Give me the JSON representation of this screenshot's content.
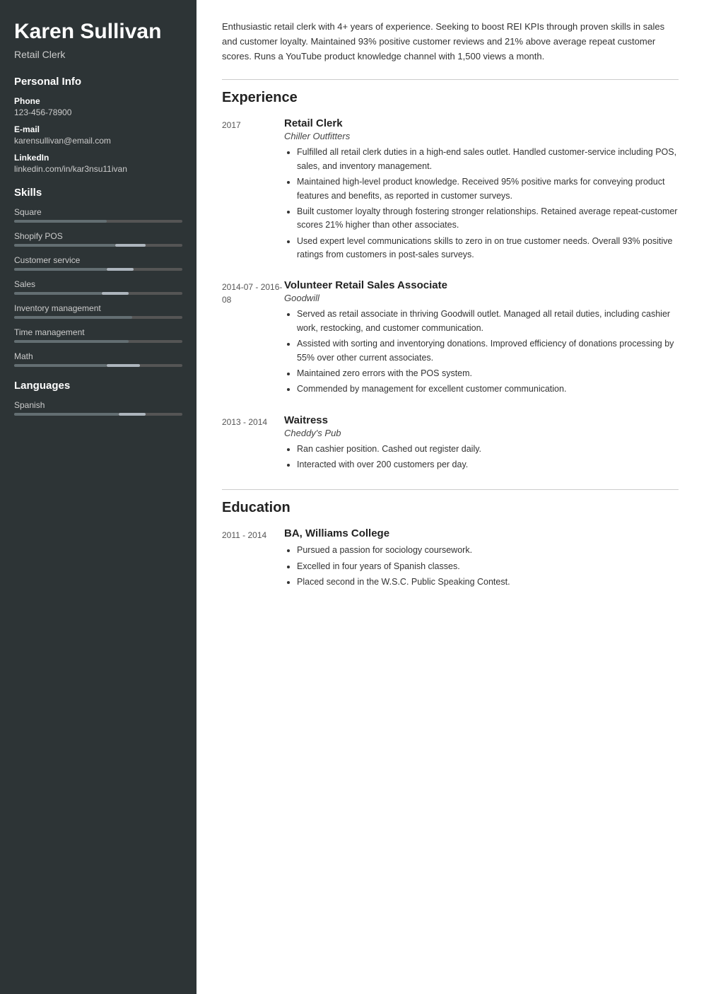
{
  "sidebar": {
    "name": "Karen Sullivan",
    "job_title": "Retail Clerk",
    "personal_info_title": "Personal Info",
    "phone_label": "Phone",
    "phone_value": "123-456-78900",
    "email_label": "E-mail",
    "email_value": "karensullivan@email.com",
    "linkedin_label": "LinkedIn",
    "linkedin_value": "linkedin.com/in/kar3nsu11ivan",
    "skills_title": "Skills",
    "skills": [
      {
        "name": "Square",
        "fill": 55,
        "accent_start": 55,
        "accent_width": 0
      },
      {
        "name": "Shopify POS",
        "fill": 60,
        "accent_start": 60,
        "accent_width": 18
      },
      {
        "name": "Customer service",
        "fill": 55,
        "accent_start": 55,
        "accent_width": 16
      },
      {
        "name": "Sales",
        "fill": 52,
        "accent_start": 52,
        "accent_width": 16
      },
      {
        "name": "Inventory management",
        "fill": 70,
        "accent_start": 70,
        "accent_width": 0
      },
      {
        "name": "Time management",
        "fill": 68,
        "accent_start": 68,
        "accent_width": 0
      },
      {
        "name": "Math",
        "fill": 55,
        "accent_start": 55,
        "accent_width": 20
      }
    ],
    "languages_title": "Languages",
    "languages": [
      {
        "name": "Spanish",
        "fill": 62,
        "accent_start": 62,
        "accent_width": 16
      }
    ]
  },
  "main": {
    "summary": "Enthusiastic retail clerk with 4+ years of experience. Seeking to boost REI KPIs through proven skills in sales and customer loyalty. Maintained 93% positive customer reviews and 21% above average repeat customer scores. Runs a YouTube product knowledge channel with 1,500 views a month.",
    "experience_title": "Experience",
    "jobs": [
      {
        "date": "2017",
        "title": "Retail Clerk",
        "company": "Chiller Outfitters",
        "bullets": [
          "Fulfilled all retail clerk duties in a high-end sales outlet. Handled customer-service including POS, sales, and inventory management.",
          "Maintained high-level product knowledge. Received 95% positive marks for conveying product features and benefits, as reported in customer surveys.",
          "Built customer loyalty through fostering stronger relationships. Retained average repeat-customer scores 21% higher than other associates.",
          "Used expert level communications skills to zero in on true customer needs. Overall 93% positive ratings from customers in post-sales surveys."
        ]
      },
      {
        "date": "2014-07 - 2016-08",
        "title": "Volunteer Retail Sales Associate",
        "company": "Goodwill",
        "bullets": [
          "Served as retail associate in thriving Goodwill outlet. Managed all retail duties, including cashier work, restocking, and customer communication.",
          "Assisted with sorting and inventorying donations. Improved efficiency of donations processing by 55% over other current associates.",
          "Maintained zero errors with the POS system.",
          "Commended by management for excellent customer communication."
        ]
      },
      {
        "date": "2013 - 2014",
        "title": "Waitress",
        "company": "Cheddy's Pub",
        "bullets": [
          "Ran cashier position. Cashed out register daily.",
          "Interacted with over 200 customers per day."
        ]
      }
    ],
    "education_title": "Education",
    "education": [
      {
        "date": "2011 - 2014",
        "degree": "BA, Williams College",
        "bullets": [
          "Pursued a passion for sociology coursework.",
          "Excelled in four years of Spanish classes.",
          "Placed second in the W.S.C. Public Speaking Contest."
        ]
      }
    ]
  }
}
